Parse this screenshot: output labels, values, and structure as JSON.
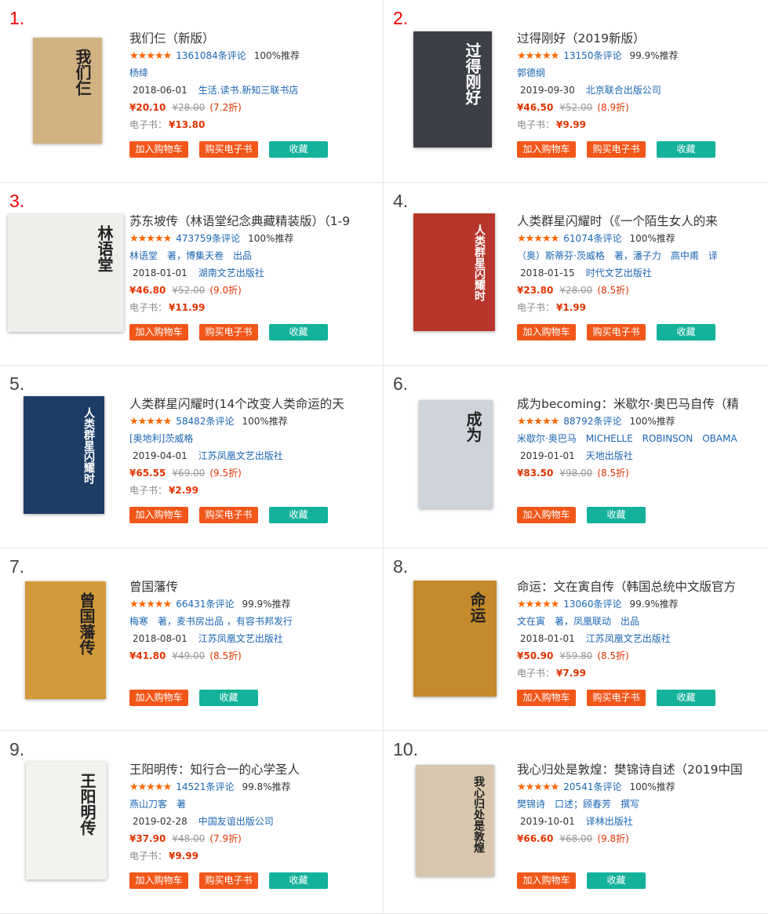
{
  "buttons": {
    "cart": "加入购物车",
    "ebook": "购买电子书",
    "fav": "收藏"
  },
  "ebook_label": "电子书：",
  "books": [
    {
      "rank": "1.",
      "title": "我们仨（新版）",
      "reviews": "1361084条评论",
      "rec": "100%推荐",
      "author": "杨绛",
      "date": "2018-06-01",
      "publisher": "生活.读书.新知三联书店",
      "price": "¥20.10",
      "orig": "¥28.00",
      "disc": "(7.2折)",
      "ebook": "¥13.80",
      "cover_text": "我们仨",
      "cover_bg": "#d2b281"
    },
    {
      "rank": "2.",
      "title": "过得刚好（2019新版）",
      "reviews": "13150条评论",
      "rec": "99.9%推荐",
      "author": "郭德纲",
      "date": "2019-09-30",
      "publisher": "北京联合出版公司",
      "price": "¥46.50",
      "orig": "¥52.00",
      "disc": "(8.9折)",
      "ebook": "¥9.99",
      "cover_text": "过得刚好",
      "cover_bg": "#3c3f45"
    },
    {
      "rank": "3.",
      "title": "苏东坡传（林语堂纪念典藏精装版）（1-9",
      "reviews": "473759条评论",
      "rec": "100%推荐",
      "author": "林语堂　著，博集天卷　出品",
      "date": "2018-01-01",
      "publisher": "湖南文艺出版社",
      "price": "¥46.80",
      "orig": "¥52.00",
      "disc": "(9.0折)",
      "ebook": "¥11.99",
      "cover_text": "林语堂",
      "cover_bg": "#ededea"
    },
    {
      "rank": "4.",
      "title": "人类群星闪耀时（《一个陌生女人的来",
      "reviews": "61074条评论",
      "rec": "100%推荐",
      "author": "（奥）斯蒂芬·茨威格　著，潘子力　高中甫　译",
      "date": "2018-01-15",
      "publisher": "时代文艺出版社",
      "price": "¥23.80",
      "orig": "¥28.00",
      "disc": "(8.5折)",
      "ebook": "¥1.99",
      "cover_text": "人类群星闪耀时",
      "cover_bg": "#b8352b"
    },
    {
      "rank": "5.",
      "title": "人类群星闪耀时(14个改变人类命运的天",
      "reviews": "58482条评论",
      "rec": "100%推荐",
      "author": "[奥地利]茨威格",
      "date": "2019-04-01",
      "publisher": "江苏凤凰文艺出版社",
      "price": "¥65.55",
      "orig": "¥69.00",
      "disc": "(9.5折)",
      "ebook": "¥2.99",
      "cover_text": "人类群星闪耀时",
      "cover_bg": "#1d3d66"
    },
    {
      "rank": "6.",
      "title": "成为becoming：米歇尔·奥巴马自传（精",
      "reviews": "88792条评论",
      "rec": "100%推荐",
      "author": "米歇尔·奥巴马　MICHELLE　ROBINSON　OBAMA",
      "date": "2019-01-01",
      "publisher": "天地出版社",
      "price": "¥83.50",
      "orig": "¥98.00",
      "disc": "(8.5折)",
      "ebook": "",
      "cover_text": "成为",
      "cover_bg": "#cfd3da"
    },
    {
      "rank": "7.",
      "title": "曾国藩传",
      "reviews": "66431条评论",
      "rec": "99.9%推荐",
      "author": "梅寒　著，麦书房出品 ，有容书邦发行",
      "date": "2018-08-01",
      "publisher": "江苏凤凰文艺出版社",
      "price": "¥41.80",
      "orig": "¥49.00",
      "disc": "(8.5折)",
      "ebook": "",
      "cover_text": "曾国藩传",
      "cover_bg": "#d39a3a"
    },
    {
      "rank": "8.",
      "title": "命运：文在寅自传（韩国总统中文版官方",
      "reviews": "13060条评论",
      "rec": "99.9%推荐",
      "author": "文在寅　著，凤凰联动　出品",
      "date": "2018-01-01",
      "publisher": "江苏凤凰文艺出版社",
      "price": "¥50.90",
      "orig": "¥59.80",
      "disc": "(8.5折)",
      "ebook": "¥7.99",
      "cover_text": "命运",
      "cover_bg": "#c58a2a"
    },
    {
      "rank": "9.",
      "title": "王阳明传：知行合一的心学圣人",
      "reviews": "14521条评论",
      "rec": "99.8%推荐",
      "author": "燕山刀客　著",
      "date": "2019-02-28",
      "publisher": "中国友谊出版公司",
      "price": "¥37.90",
      "orig": "¥48.00",
      "disc": "(7.9折)",
      "ebook": "¥9.99",
      "cover_text": "王阳明传",
      "cover_bg": "#f3f2ef"
    },
    {
      "rank": "10.",
      "title": "我心归处是敦煌：樊锦诗自述（2019中国",
      "reviews": "20541条评论",
      "rec": "100%推荐",
      "author": "樊锦诗　口述；顾春芳　撰写",
      "date": "2019-10-01",
      "publisher": "译林出版社",
      "price": "¥66.60",
      "orig": "¥68.00",
      "disc": "(9.8折)",
      "ebook": "",
      "cover_text": "我心归处是敦煌",
      "cover_bg": "#d8c7ae"
    }
  ]
}
